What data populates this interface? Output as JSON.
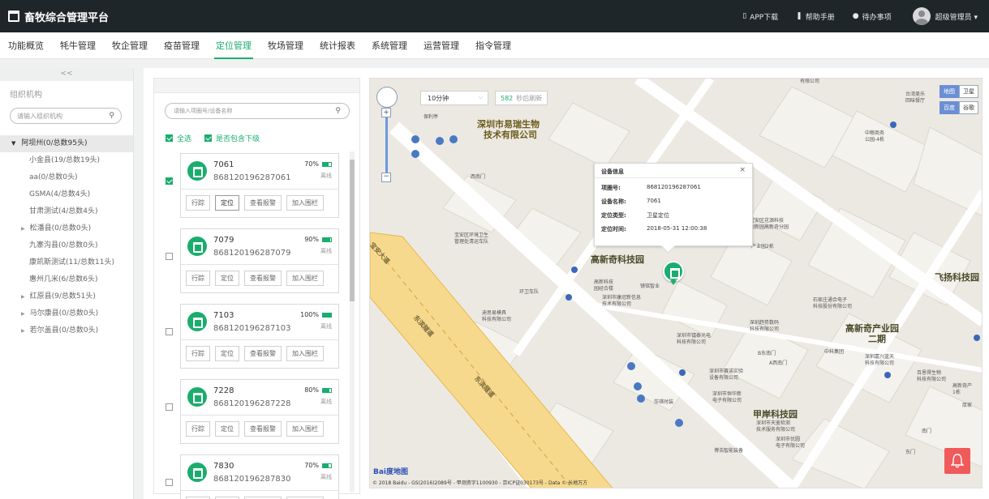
{
  "app": {
    "title": "畜牧综合管理平台"
  },
  "topbar": {
    "app_download": "APP下载",
    "help": "帮助手册",
    "todo": "待办事项",
    "user": "超级管理员 ▾"
  },
  "nav": {
    "items": [
      "功能概览",
      "牦牛管理",
      "牧企管理",
      "疫苗管理",
      "定位管理",
      "牧场管理",
      "统计报表",
      "系统管理",
      "运营管理",
      "指令管理"
    ],
    "active_index": 4
  },
  "sidebar": {
    "collapse": "<<",
    "title": "组织机构",
    "search_placeholder": "请输入组织机构",
    "root": "阿坝州(0/总数95头)",
    "items": [
      {
        "label": "小金县(19/总数19头)",
        "expandable": false
      },
      {
        "label": "aa(0/总数0头)",
        "expandable": false
      },
      {
        "label": "GSMA(4/总数4头)",
        "expandable": false
      },
      {
        "label": "甘肃测试(4/总数4头)",
        "expandable": false
      },
      {
        "label": "松潘县(0/总数0头)",
        "expandable": true
      },
      {
        "label": "九寨沟县(0/总数0头)",
        "expandable": false
      },
      {
        "label": "康凯斯测试(11/总数11头)",
        "expandable": false
      },
      {
        "label": "惠州几米(6/总数6头)",
        "expandable": false
      },
      {
        "label": "红原县(9/总数51头)",
        "expandable": true
      },
      {
        "label": "马尔康县(0/总数0头)",
        "expandable": true
      },
      {
        "label": "若尔盖县(0/总数0头)",
        "expandable": true
      }
    ]
  },
  "device_list": {
    "search_placeholder": "请输入项圈号/设备名称",
    "select_all": "全选",
    "include_sub": "是否包含下级",
    "buttons": [
      "行踪",
      "定位",
      "查看报警",
      "加入围栏"
    ],
    "offline_label": "离线",
    "devices": [
      {
        "name": "7061",
        "imei": "868120196287061",
        "battery": "70%",
        "battery_level": 0.7,
        "checked": true
      },
      {
        "name": "7079",
        "imei": "868120196287079",
        "battery": "90%",
        "battery_level": 0.9,
        "checked": false
      },
      {
        "name": "7103",
        "imei": "868120196287103",
        "battery": "100%",
        "battery_level": 1.0,
        "checked": false
      },
      {
        "name": "7228",
        "imei": "868120196287228",
        "battery": "80%",
        "battery_level": 0.8,
        "checked": false
      },
      {
        "name": "7830",
        "imei": "868120196287830",
        "battery": "70%",
        "battery_level": 0.7,
        "checked": false
      }
    ]
  },
  "map": {
    "interval": "10分钟",
    "refresh_seconds": "582",
    "refresh_suffix": "秒后刷新",
    "map_types": [
      "地图",
      "卫星",
      "百度",
      "谷歌"
    ],
    "info": {
      "title": "设备信息",
      "close": "×",
      "rows": [
        {
          "k": "项圈号:",
          "v": "868120196287061"
        },
        {
          "k": "设备名称:",
          "v": "7061"
        },
        {
          "k": "定位类型:",
          "v": "卫星定位"
        },
        {
          "k": "定位时间:",
          "v": "2018-05-31 12:00:38"
        }
      ]
    },
    "labels": {
      "company1": "深圳市易瑞生物",
      "company1b": "技术有限公司",
      "park1": "高新奇科技园",
      "park2": "高新奇产业园",
      "park2b": "二期",
      "park3": "甲岸科技园",
      "park4": "飞扬科技园",
      "road1": "东滨隧道",
      "road2": "东滨隧道",
      "road3": "宝安大道",
      "poi_baoli": "保利亭",
      "poi_xinanmen": "西南门",
      "poi_huanwei": "宝安区环境卫生\n管理处清运车队",
      "poi_huanweidui": "环卫车队",
      "poi_dishi": "迪思易模具\n科技有限公司",
      "poi_gaoxin": "高新科技\n园经合楼",
      "poi_jinghong": "镜铭智业",
      "poi_shenzhen_kangguan": "深圳市康冠新信息\n技术有限公司",
      "poi_zhongliang": "中粮商务\n公园-4栋",
      "poi_taiwan": "台湾美乐\n回味餐厅",
      "poi_qunmei": "有限公司",
      "poi_baohua": "宝安区花源科技\n创新园高新奇分园",
      "poi_chanye2": "产业园2栋",
      "poi_shiyuan": "石家庄通合电子\n科技股份有限公司",
      "poi_qushi": "深圳趋势数码\n科技有限公司",
      "poi_dingtai": "深圳市镭泰光电\n科技有限公司",
      "poi_bdongnan": "B东南门",
      "poi_axinanmen": "A西南门",
      "poi_zhongke": "中科集团",
      "poi_jiaxing": "深圳嘉兴蓝天\n科技有限公司",
      "poi_saiyuan": "深圳市赛诺实验\n设备有限公司",
      "poi_shengwu": "深圳市恒华新\n电子有限公司",
      "poi_shaxi": "莎琪时装",
      "poi_tiantong": "深圳市天鉴检测\n技术服务有限公司",
      "poi_youlian": "深圳市优圆\n电子有限公司",
      "poi_bochuang": "博浩智能装备",
      "poi_baiheng": "百恩得生物\n科技有限公司",
      "poi_gaoxinqi": "高新奇产\n1栋",
      "poi_houjia": "厚家",
      "poi_nanmen": "南门",
      "poi_dongmen": "东门"
    },
    "baidu": "Bai度地图",
    "copyright": "© 2018 Baidu - GS(2016)2089号 - 甲测资字1100930 - 京ICP证030173号 - Data © 长地万方"
  }
}
